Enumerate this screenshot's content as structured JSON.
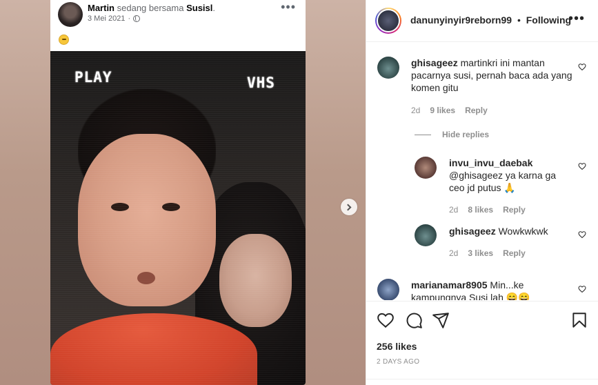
{
  "facebook_post": {
    "author": "Martin",
    "with_text": "sedang bersama",
    "tagged": "Susisl",
    "tag_period": ".",
    "date": "3 Mei 2021",
    "dot": "·",
    "more": "•••",
    "photo_overlay_left": "PLAY",
    "photo_overlay_right": "VHS"
  },
  "post": {
    "author": "danunyinyir9reborn99",
    "separator": "•",
    "follow_status": "Following",
    "more": "•••"
  },
  "comments": [
    {
      "user": "ghisageez",
      "text": "martinkri ini mantan pacarnya susi, pernah baca ada yang komen gitu",
      "age": "2d",
      "likes": "9 likes",
      "reply": "Reply"
    }
  ],
  "hide_replies": "Hide replies",
  "replies": [
    {
      "user": "invu_invu_daebak",
      "text": "@ghisageez ya karna ga ceo jd putus 🙏",
      "age": "2d",
      "likes": "8 likes",
      "reply": "Reply"
    },
    {
      "user": "ghisageez",
      "text": "Wowkwkwk",
      "age": "2d",
      "likes": "3 likes",
      "reply": "Reply"
    }
  ],
  "last_comment": {
    "user": "marianamar8905",
    "text": "Min...ke kampungnya Susi lah 😄😄"
  },
  "likes_count": "256 likes",
  "timestamp": "2 DAYS AGO",
  "colors": {
    "text": "#262626",
    "secondary": "#8e8e8e",
    "border": "#efefef"
  }
}
